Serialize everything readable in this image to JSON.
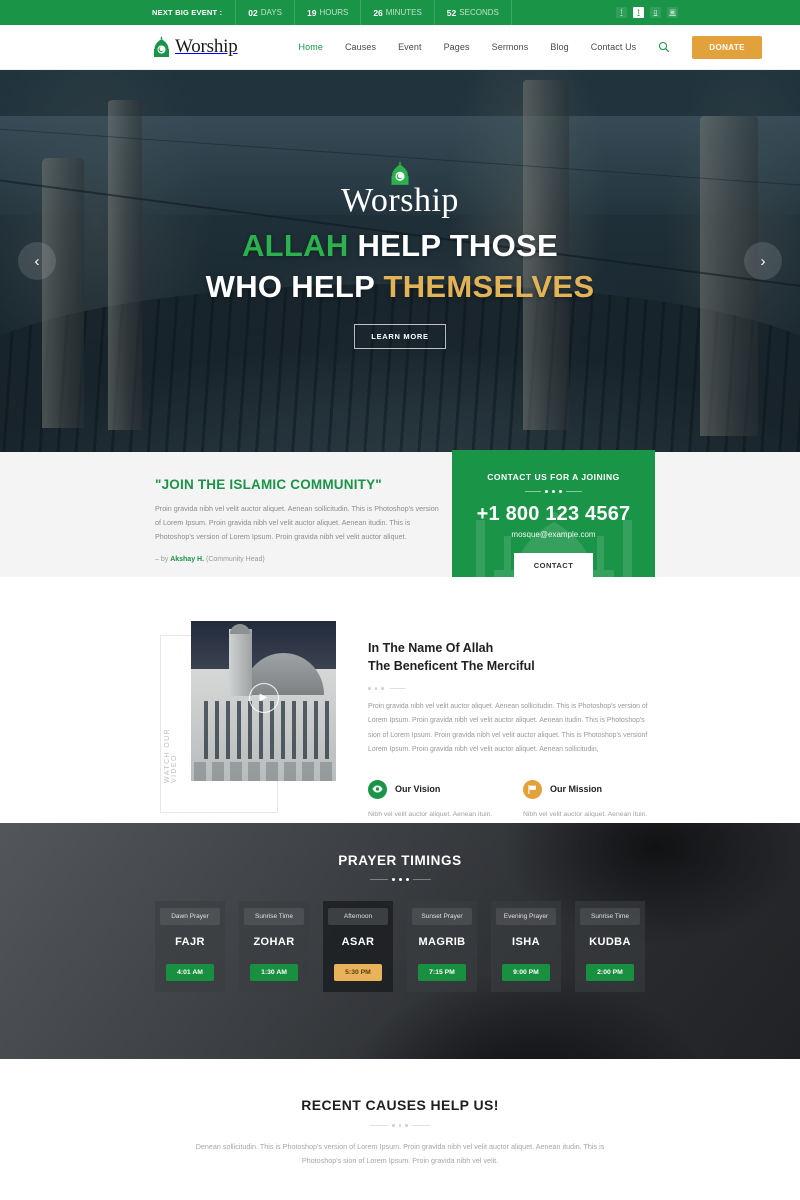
{
  "topbar": {
    "label": "NEXT BIG EVENT :",
    "countdown": [
      {
        "num": "02",
        "unit": "DAYS"
      },
      {
        "num": "19",
        "unit": "HOURS"
      },
      {
        "num": "26",
        "unit": "MINUTES"
      },
      {
        "num": "52",
        "unit": "SECONDS"
      }
    ],
    "social": [
      {
        "name": "facebook-icon",
        "glyph": "f"
      },
      {
        "name": "twitter-icon",
        "glyph": "t"
      },
      {
        "name": "google-plus-icon",
        "glyph": "g"
      },
      {
        "name": "instagram-icon",
        "glyph": "▣"
      }
    ],
    "bg_color": "#1a9447"
  },
  "nav": {
    "brand": "Worship",
    "items": [
      {
        "label": "Home",
        "active": true
      },
      {
        "label": "Causes",
        "active": false
      },
      {
        "label": "Event",
        "active": false
      },
      {
        "label": "Pages",
        "active": false
      },
      {
        "label": "Sermons",
        "active": false
      },
      {
        "label": "Blog",
        "active": false
      },
      {
        "label": "Contact Us",
        "active": false
      }
    ],
    "search_icon": "search-icon",
    "donate_label": "DONATE",
    "donate_color": "#e3a13c",
    "accent_color": "#1a9447"
  },
  "hero": {
    "logo_text": "Worship",
    "line1_green": "ALLAH",
    "line1_white": "HELP THOSE",
    "line2_white": "WHO HELP",
    "line2_gold": "THEMSELVES",
    "cta": "LEARN MORE",
    "prev_arrow": "‹",
    "next_arrow": "›",
    "green": "#2bb14e",
    "gold": "#e3b457"
  },
  "join": {
    "title": "\"JOIN THE ISLAMIC COMMUNITY\"",
    "body": "Proin gravida nibh vel velit auctor aliquet. Aenean sollicitudin. This is Photoshop's version of Lorem Ipsum. Proin gravida nibh vel velit auctor aliquet. Aenean itudin. This is Photoshop's version of Lorem Ipsum. Proin gravida nibh vel velit auctor aliquet.",
    "by_prefix": "– by ",
    "by_name": "Akshay H.",
    "by_suffix": " (Community Head)"
  },
  "contact_card": {
    "title": "CONTACT US FOR A JOINING",
    "phone": "+1 800 123 4567",
    "email": "mosque@example.com",
    "button": "CONTACT",
    "bg_color": "#1a9447"
  },
  "about": {
    "video_label": "WATCH OUR VIDEO",
    "play_icon": "play-icon",
    "heading_line1": "In The Name Of Allah",
    "heading_line2": "The Beneficent The Merciful",
    "paragraph": "Proin gravida nibh vel velit auctor aliquet. Aenean sollicitudin. This is Photoshop's version of Lorem Ipsum. Proin gravida nibh vel velit auctor aliquet. Aenean itudin. This is Photoshop's sion of Lorem Ipsum. Proin gravida nibh vel velit auctor aliquet. This is Photoshop's versionf Lorem Ipsum. Proin gravida nibh vel velit auctor aliquet. Aenean sollicitudin,",
    "vision": {
      "icon": "eye-icon",
      "title": "Our Vision",
      "text": "Nibh vel velit auctor aliquet. Aenean ituin. This is Photoshop's version of Phooshop's sion of Lorem.",
      "color": "#1a9447"
    },
    "mission": {
      "icon": "flag-icon",
      "title": "Our Mission",
      "text": "Nibh vel velit auctor aliquet. Aenean ituin. This is Photoshop's version of Phooshop's sion of Lorem.",
      "color": "#e3a13c"
    }
  },
  "prayer": {
    "title": "PRAYER TIMINGS",
    "cards": [
      {
        "sub": "Dawn Prayer",
        "name": "FAJR",
        "time": "4:01 AM",
        "active": false
      },
      {
        "sub": "Sunrise Time",
        "name": "ZOHAR",
        "time": "1:30 AM",
        "active": false
      },
      {
        "sub": "Afternoon",
        "name": "ASAR",
        "time": "5:30 PM",
        "active": true
      },
      {
        "sub": "Sunset Prayer",
        "name": "MAGRIB",
        "time": "7:15 PM",
        "active": false
      },
      {
        "sub": "Evening Prayer",
        "name": "ISHA",
        "time": "9:00 PM",
        "active": false
      },
      {
        "sub": "Sunrise Time",
        "name": "KUDBA",
        "time": "2:00 PM",
        "active": false
      }
    ],
    "badge_color": "#18903f",
    "active_badge_color": "#e9b35a"
  },
  "causes": {
    "title": "RECENT CAUSES HELP US!",
    "paragraph": "Denean sollicitudin. This is Photoshop's version of Lorem Ipsum. Proin gravida nibh vel velit auctor aliquet. Aenean itudin. This is Photoshop's sion of Lorem Ipsum. Proin gravida nibh vel velit."
  }
}
